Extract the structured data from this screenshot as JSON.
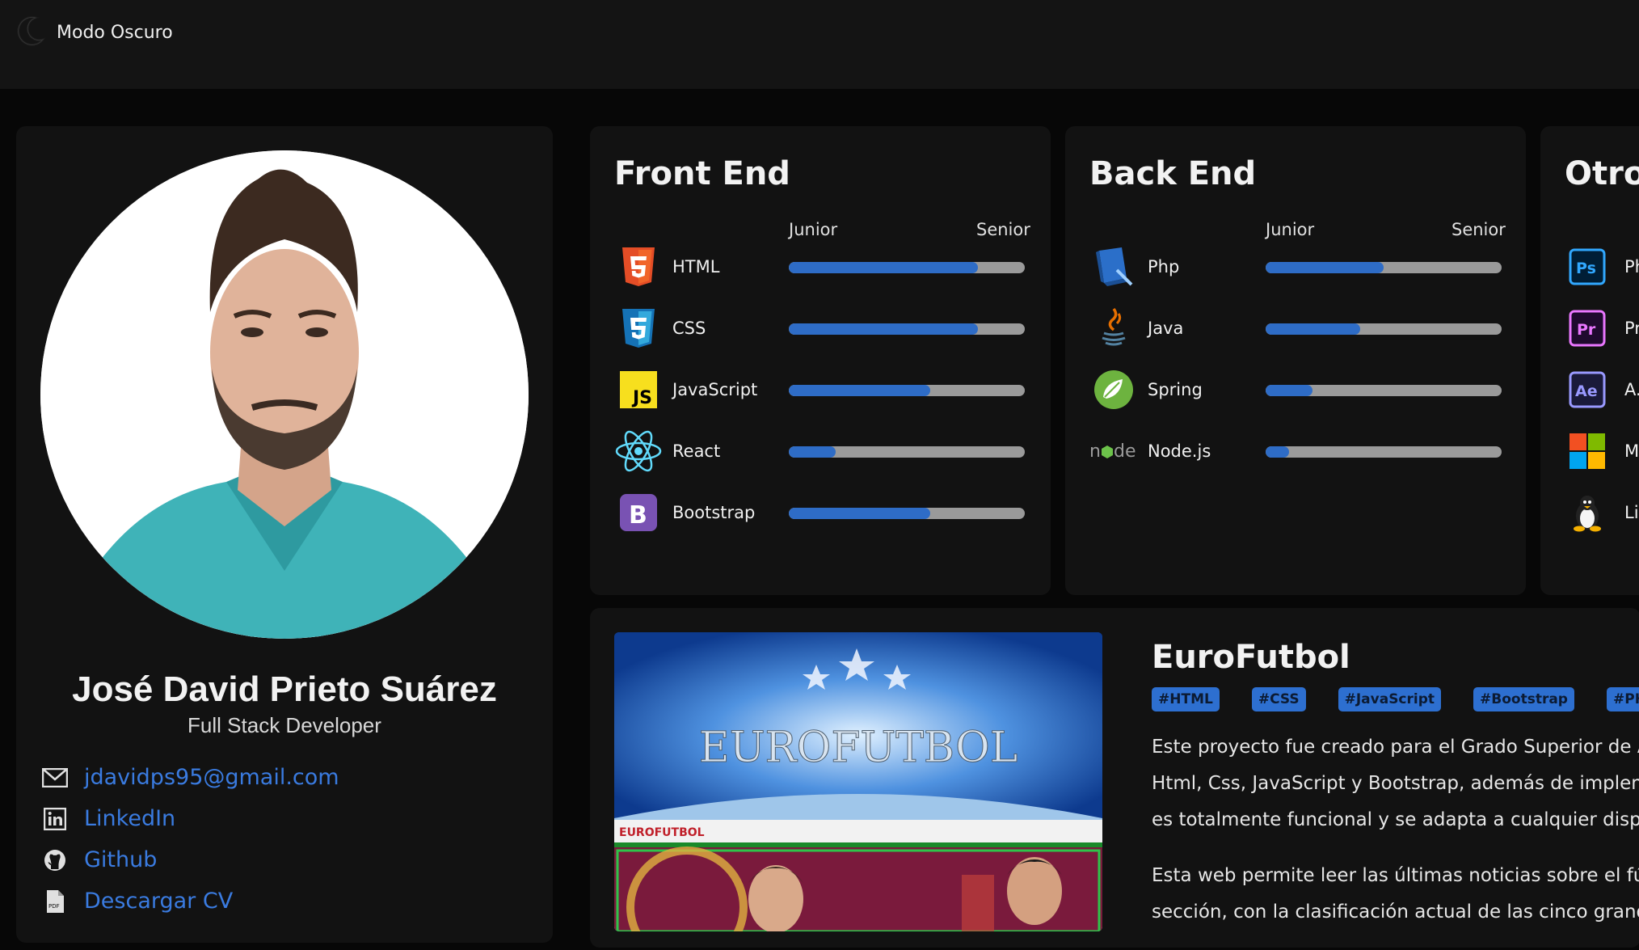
{
  "header": {
    "dark_mode_label": "Modo Oscuro"
  },
  "profile": {
    "name": "José David Prieto Suárez",
    "role": "Full Stack Developer",
    "contacts": [
      {
        "label": "jdavidps95@gmail.com",
        "icon": "mail-icon"
      },
      {
        "label": "LinkedIn",
        "icon": "linkedin-icon"
      },
      {
        "label": "Github",
        "icon": "github-icon"
      },
      {
        "label": "Descargar CV",
        "icon": "pdf-icon"
      }
    ]
  },
  "skills": {
    "scale_low": "Junior",
    "scale_high": "Senior",
    "front": {
      "title": "Front End",
      "items": [
        {
          "name": "HTML",
          "level": 0.8,
          "icon": "html5-icon"
        },
        {
          "name": "CSS",
          "level": 0.8,
          "icon": "css3-icon"
        },
        {
          "name": "JavaScript",
          "level": 0.6,
          "icon": "javascript-icon"
        },
        {
          "name": "React",
          "level": 0.2,
          "icon": "react-icon"
        },
        {
          "name": "Bootstrap",
          "level": 0.6,
          "icon": "bootstrap-icon"
        }
      ]
    },
    "back": {
      "title": "Back End",
      "items": [
        {
          "name": "Php",
          "level": 0.5,
          "icon": "php-icon"
        },
        {
          "name": "Java",
          "level": 0.4,
          "icon": "java-icon"
        },
        {
          "name": "Spring",
          "level": 0.2,
          "icon": "spring-icon"
        },
        {
          "name": "Node.js",
          "level": 0.1,
          "icon": "nodejs-icon"
        }
      ]
    },
    "others": {
      "title": "Otros",
      "items": [
        {
          "name": "Ph",
          "icon": "photoshop-icon",
          "badge": "Ps"
        },
        {
          "name": "Pr",
          "icon": "premiere-icon",
          "badge": "Pr"
        },
        {
          "name": "A...",
          "icon": "after-effects-icon",
          "badge": "Ae"
        },
        {
          "name": "M",
          "icon": "microsoft-icon"
        },
        {
          "name": "Li",
          "icon": "linux-icon"
        }
      ]
    }
  },
  "project": {
    "title": "EuroFutbol",
    "image_caption": "EUROFUTBOL",
    "image_brand": "EUROFUTBOL",
    "tags": [
      "#HTML",
      "#CSS",
      "#JavaScript",
      "#Bootstrap",
      "#PHP"
    ],
    "description_lines": [
      "Este proyecto fue creado para el Grado Superior de ASI",
      "Html, Css, JavaScript y Bootstrap, además de implemer",
      "es totalmente funcional y se adapta a cualquier disposi"
    ],
    "description_lines_2": [
      "Esta web permite leer las últimas noticias sobre el fútb",
      "sección, con la clasificación actual de las cinco grandes"
    ]
  },
  "colors": {
    "accent": "#2e6cc6",
    "link": "#3a7be0",
    "background": "#070707",
    "card": "#121212"
  }
}
